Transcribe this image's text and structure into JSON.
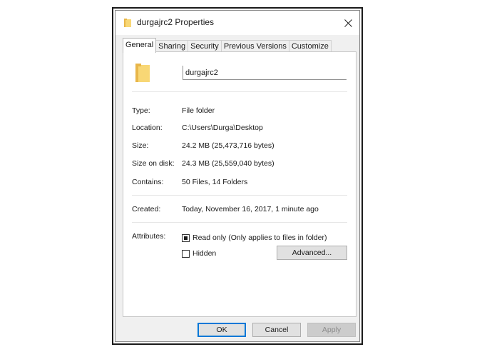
{
  "window": {
    "title": "durgajrc2 Properties",
    "close_glyph": "✕"
  },
  "tabs": [
    {
      "label": "General",
      "active": true
    },
    {
      "label": "Sharing",
      "active": false
    },
    {
      "label": "Security",
      "active": false
    },
    {
      "label": "Previous Versions",
      "active": false
    },
    {
      "label": "Customize",
      "active": false
    }
  ],
  "general": {
    "folder_icon": "folder-icon",
    "name_value": "durgajrc2",
    "properties": {
      "type": {
        "label": "Type:",
        "value": "File folder"
      },
      "location": {
        "label": "Location:",
        "value": "C:\\Users\\Durga\\Desktop"
      },
      "size": {
        "label": "Size:",
        "value": "24.2 MB (25,473,716 bytes)"
      },
      "size_on_disk": {
        "label": "Size on disk:",
        "value": "24.3 MB (25,559,040 bytes)"
      },
      "contains": {
        "label": "Contains:",
        "value": "50 Files, 14 Folders"
      },
      "created": {
        "label": "Created:",
        "value": "Today, November 16, 2017, 1 minute ago"
      }
    },
    "attributes": {
      "label": "Attributes:",
      "read_only": {
        "label": "Read only (Only applies to files in folder)",
        "state": "indeterminate"
      },
      "hidden": {
        "label": "Hidden",
        "state": "unchecked"
      },
      "advanced_label": "Advanced..."
    }
  },
  "footer": {
    "ok_label": "OK",
    "cancel_label": "Cancel",
    "apply_label": "Apply"
  },
  "colors": {
    "folder_yellow": "#f8d775",
    "folder_dark": "#e8b64a",
    "focus_blue": "#0078d7"
  }
}
